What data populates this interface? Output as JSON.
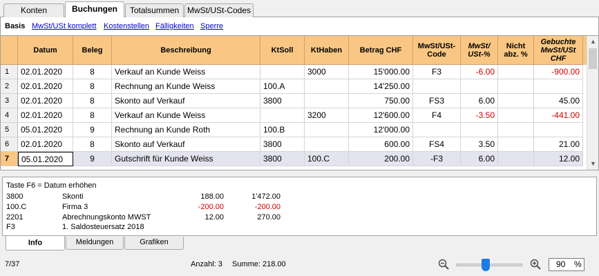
{
  "top_tabs": [
    "Konten",
    "Buchungen",
    "Totalsummen",
    "MwSt/USt-Codes"
  ],
  "sub_tabs": [
    "Basis",
    "MwSt/USt komplett",
    "Kostenstellen",
    "Fälligkeiten",
    "Sperre"
  ],
  "table": {
    "columns": [
      "Datum",
      "Beleg",
      "Beschreibung",
      "KtSoll",
      "KtHaben",
      "Betrag CHF",
      "MwSt/USt-Code",
      "MwSt/ USt-%",
      "Nicht abz. %",
      "Gebuchte MwSt/USt CHF"
    ],
    "rows": [
      {
        "n": "1",
        "datum": "02.01.2020",
        "beleg": "8",
        "beschreibung": "Verkauf an Kunde Weiss",
        "soll": "",
        "haben": "3000",
        "betrag": "15'000.00",
        "code": "F3",
        "pct": "-6.00",
        "nicht": "",
        "gebucht": "-900.00"
      },
      {
        "n": "2",
        "datum": "02.01.2020",
        "beleg": "8",
        "beschreibung": "Rechnung an Kunde Weiss",
        "soll": "100.A",
        "haben": "",
        "betrag": "14'250.00",
        "code": "",
        "pct": "",
        "nicht": "",
        "gebucht": ""
      },
      {
        "n": "3",
        "datum": "02.01.2020",
        "beleg": "8",
        "beschreibung": "Skonto auf Verkauf",
        "soll": "3800",
        "haben": "",
        "betrag": "750.00",
        "code": "FS3",
        "pct": "6.00",
        "nicht": "",
        "gebucht": "45.00"
      },
      {
        "n": "4",
        "datum": "02.01.2020",
        "beleg": "8",
        "beschreibung": "Verkauf an Kunde Weiss",
        "soll": "",
        "haben": "3200",
        "betrag": "12'600.00",
        "code": "F4",
        "pct": "-3.50",
        "nicht": "",
        "gebucht": "-441.00"
      },
      {
        "n": "5",
        "datum": "05.01.2020",
        "beleg": "9",
        "beschreibung": "Rechnung an Kunde Roth",
        "soll": "100.B",
        "haben": "",
        "betrag": "12'000.00",
        "code": "",
        "pct": "",
        "nicht": "",
        "gebucht": ""
      },
      {
        "n": "6",
        "datum": "02.01.2020",
        "beleg": "8",
        "beschreibung": "Skonto auf Verkauf",
        "soll": "3800",
        "haben": "",
        "betrag": "600.00",
        "code": "FS4",
        "pct": "3.50",
        "nicht": "",
        "gebucht": "21.00"
      },
      {
        "n": "7",
        "datum": "05.01.2020",
        "beleg": "9",
        "beschreibung": "Gutschrift für Kunde Weiss",
        "soll": "3800",
        "haben": "100.C",
        "betrag": "200.00",
        "code": "-F3",
        "pct": "6.00",
        "nicht": "",
        "gebucht": "12.00"
      }
    ]
  },
  "scrollbar": {
    "up": "▲",
    "down": "▼"
  },
  "info": {
    "hint": "Taste F6 = Datum erhöhen",
    "rows": [
      {
        "a": "3800",
        "b": "Skonti",
        "c": "188.00",
        "d": "1'472.00"
      },
      {
        "a": "100.C",
        "b": "Firma 3",
        "c": "-200.00",
        "d": "-200.00"
      },
      {
        "a": "2201",
        "b": "Abrechnungskonto MWST",
        "c": "12.00",
        "d": "270.00"
      },
      {
        "a": "F3",
        "b": "1. Saldosteuersatz 2018",
        "c": "",
        "d": ""
      }
    ]
  },
  "bottom_tabs": [
    "Info",
    "Meldungen",
    "Grafiken"
  ],
  "status": {
    "position": "7/37",
    "anzahl": "Anzahl: 3",
    "summe": "Summe: 218.00",
    "zoom_value": "90",
    "zoom_unit": "%",
    "zoom_level": 0.45
  },
  "colors": {
    "header_bg": "#f9c783",
    "negative": "#d00000",
    "link": "#0000cc",
    "slider_thumb": "#1e7de0"
  }
}
